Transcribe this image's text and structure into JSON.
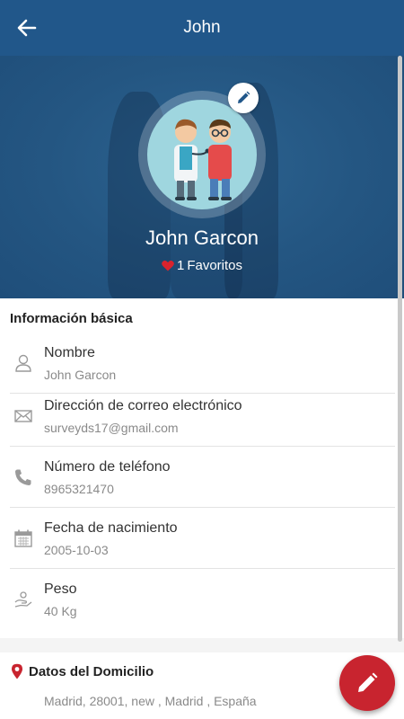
{
  "header": {
    "title": "John",
    "back_icon": "arrow-left-icon"
  },
  "profile": {
    "name": "John Garcon",
    "favorites_count": "1",
    "favorites_label": "Favoritos",
    "heart_color": "#d9232d",
    "edit_icon": "pencil-icon"
  },
  "basic_info": {
    "title": "Información básica",
    "rows": [
      {
        "label": "Nombre",
        "value": "John Garcon",
        "icon": "person-icon"
      },
      {
        "label": "Dirección de correo electrónico",
        "value": "surveyds17@gmail.com",
        "icon": "mail-icon"
      },
      {
        "label": "Número de teléfono",
        "value": "8965321470",
        "icon": "phone-icon"
      },
      {
        "label": "Fecha de nacimiento",
        "value": "2005-10-03",
        "icon": "calendar-icon"
      },
      {
        "label": "Peso",
        "value": "40 Kg",
        "icon": "scale-icon"
      }
    ]
  },
  "address": {
    "title": "Datos del Domicilio",
    "value": "Madrid, 28001, new , Madrid , España",
    "icon": "location-pin-icon"
  },
  "colors": {
    "primary": "#21578a",
    "accent": "#c8242f",
    "text": "#333333",
    "muted": "#8a8a8a"
  }
}
